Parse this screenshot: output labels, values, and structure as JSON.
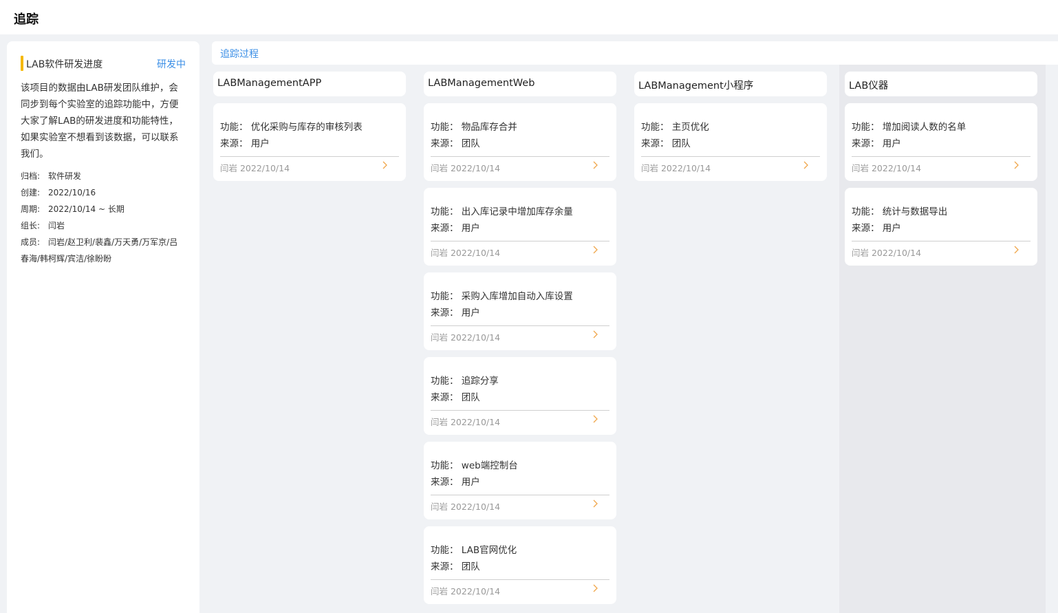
{
  "header": {
    "title": "追踪"
  },
  "project": {
    "name": "LAB软件研发进度",
    "status": "研发中",
    "status_color": "#3a8ee6",
    "accent_color": "#f5b800",
    "description": "该项目的数据由LAB研发团队维护，会同步到每个实验室的追踪功能中，方便大家了解LAB的研发进度和功能特性，如果实验室不想看到该数据，可以联系我们。",
    "meta": [
      {
        "label": "归档:",
        "value": "软件研发"
      },
      {
        "label": "创建:",
        "value": "2022/10/16"
      },
      {
        "label": "周期:",
        "value": "2022/10/14 ~ 长期"
      },
      {
        "label": "组长:",
        "value": "闫岩"
      },
      {
        "label": "成员:",
        "value": "闫岩/赵卫利/裴鑫/万天勇/万军京/吕春海/韩柯辉/宾洁/徐盼盼"
      }
    ]
  },
  "main": {
    "section_title": "追踪过程",
    "columns": [
      {
        "title": "LABManagementAPP",
        "cards": [
          {
            "feature": "功能： 优化采购与库存的审核列表",
            "source": "来源： 用户",
            "author": "闫岩 2022/10/14"
          }
        ]
      },
      {
        "title": "LABManagementWeb",
        "cards": [
          {
            "feature": "功能： 物品库存合并",
            "source": "来源： 团队",
            "author": "闫岩 2022/10/14"
          },
          {
            "feature": "功能： 出入库记录中增加库存余量",
            "source": "来源： 用户",
            "author": "闫岩 2022/10/14"
          },
          {
            "feature": "功能： 采购入库增加自动入库设置",
            "source": "来源： 用户",
            "author": "闫岩 2022/10/14"
          },
          {
            "feature": "功能： 追踪分享",
            "source": "来源： 团队",
            "author": "闫岩 2022/10/14"
          },
          {
            "feature": "功能： web端控制台",
            "source": "来源： 用户",
            "author": "闫岩 2022/10/14"
          },
          {
            "feature": "功能： LAB官网优化",
            "source": "来源： 团队",
            "author": "闫岩 2022/10/14"
          }
        ]
      },
      {
        "title": "LABManagement小程序",
        "cards": [
          {
            "feature": "功能： 主页优化",
            "source": "来源： 团队",
            "author": "闫岩 2022/10/14"
          }
        ]
      },
      {
        "title": "LAB仪器",
        "cards": [
          {
            "feature": "功能： 增加阅读人数的名单",
            "source": "来源： 用户",
            "author": "闫岩 2022/10/14"
          },
          {
            "feature": "功能： 统计与数据导出",
            "source": "来源： 用户",
            "author": "闫岩 2022/10/14"
          }
        ]
      }
    ]
  },
  "chevron_color": "#f0a64a"
}
